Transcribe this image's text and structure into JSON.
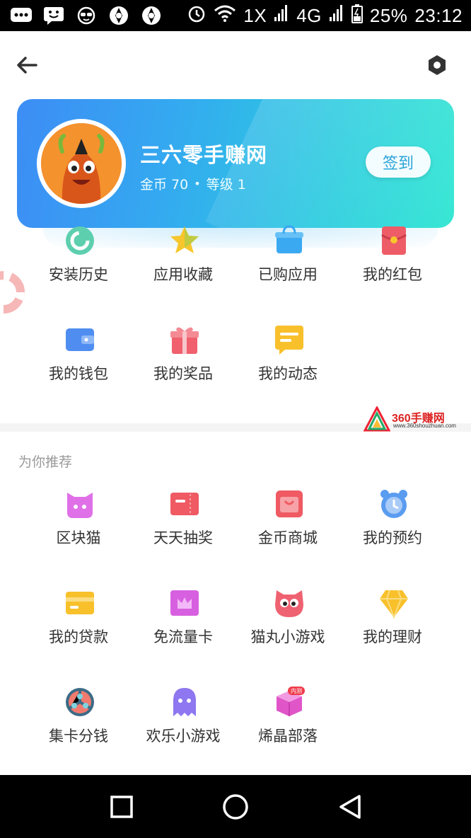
{
  "status_bar": {
    "network_1": "1X",
    "network_2": "4G",
    "battery": "25%",
    "time": "23:12"
  },
  "profile": {
    "name": "三六零手赚网",
    "coins_label": "金币 70",
    "separator": "•",
    "level_label": "等级 1",
    "checkin_label": "签到"
  },
  "menu_top": [
    {
      "label": "安装历史",
      "icon": "history-icon"
    },
    {
      "label": "应用收藏",
      "icon": "star-icon"
    },
    {
      "label": "已购应用",
      "icon": "shopping-bag-icon"
    },
    {
      "label": "我的红包",
      "icon": "red-envelope-icon"
    },
    {
      "label": "我的钱包",
      "icon": "wallet-icon"
    },
    {
      "label": "我的奖品",
      "icon": "gift-icon"
    },
    {
      "label": "我的动态",
      "icon": "message-icon"
    }
  ],
  "watermark": {
    "title": "360手赚网",
    "url": "www.360shouzhuan.com"
  },
  "recommend": {
    "title": "为你推荐",
    "items": [
      {
        "label": "区块猫",
        "icon": "cat-icon"
      },
      {
        "label": "天天抽奖",
        "icon": "lottery-ticket-icon"
      },
      {
        "label": "金币商城",
        "icon": "store-icon"
      },
      {
        "label": "我的预约",
        "icon": "alarm-clock-icon"
      },
      {
        "label": "我的贷款",
        "icon": "credit-card-icon"
      },
      {
        "label": "免流量卡",
        "icon": "crown-card-icon"
      },
      {
        "label": "猫丸小游戏",
        "icon": "cat-ball-game-icon"
      },
      {
        "label": "我的理财",
        "icon": "diamond-icon"
      },
      {
        "label": "集卡分钱",
        "icon": "card-collect-icon"
      },
      {
        "label": "欢乐小游戏",
        "icon": "ghost-game-icon"
      },
      {
        "label": "烯晶部落",
        "icon": "crystal-box-icon",
        "badge": "内测"
      }
    ]
  },
  "colors": {
    "card_gradient_start": "#3d8df5",
    "card_gradient_end": "#2ee6d2",
    "checkin_text": "#2aa4d8",
    "label_text": "#333333",
    "section_title": "#999999"
  }
}
